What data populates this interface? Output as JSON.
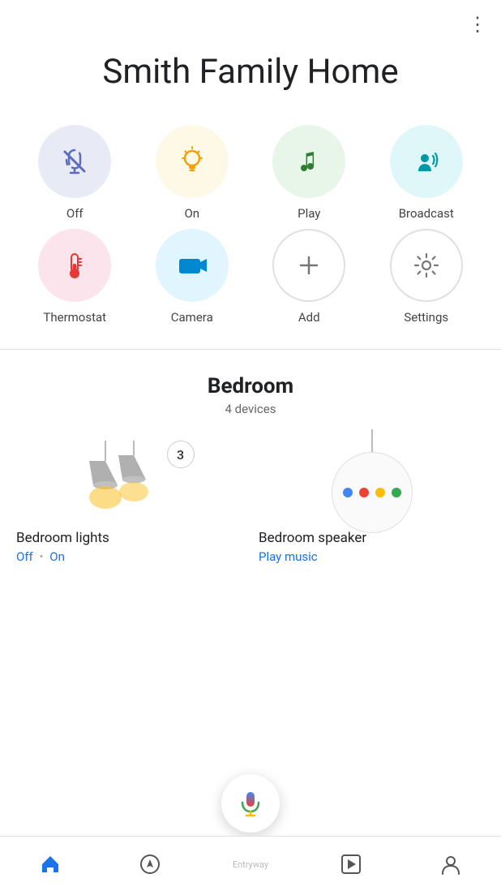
{
  "header": {
    "title": "Smith Family Home",
    "more_icon": "⋮"
  },
  "quick_actions": [
    {
      "id": "off",
      "label": "Off",
      "circle_class": "circle-off",
      "icon": "mic-off"
    },
    {
      "id": "on",
      "label": "On",
      "circle_class": "circle-on",
      "icon": "lightbulb"
    },
    {
      "id": "play",
      "label": "Play",
      "circle_class": "circle-play",
      "icon": "music-note"
    },
    {
      "id": "broadcast",
      "label": "Broadcast",
      "circle_class": "circle-broadcast",
      "icon": "broadcast"
    },
    {
      "id": "thermostat",
      "label": "Thermostat",
      "circle_class": "circle-thermostat",
      "icon": "thermostat"
    },
    {
      "id": "camera",
      "label": "Camera",
      "circle_class": "circle-camera",
      "icon": "camera"
    },
    {
      "id": "add",
      "label": "Add",
      "circle_class": "circle-add",
      "icon": "plus"
    },
    {
      "id": "settings",
      "label": "Settings",
      "circle_class": "circle-settings",
      "icon": "gear"
    }
  ],
  "room": {
    "name": "Bedroom",
    "device_count": "4 devices"
  },
  "devices": [
    {
      "id": "bedroom-lights",
      "name": "Bedroom lights",
      "status_off": "Off",
      "separator": "•",
      "status_on": "On",
      "badge": "3"
    },
    {
      "id": "bedroom-speaker",
      "name": "Bedroom speaker",
      "action": "Play music"
    }
  ],
  "bottom_nav": [
    {
      "id": "home",
      "label": "",
      "icon": "home",
      "active": true
    },
    {
      "id": "explore",
      "label": "",
      "icon": "compass",
      "active": false
    },
    {
      "id": "entryway",
      "label": "Entryway",
      "icon": "",
      "active": false
    },
    {
      "id": "routines",
      "label": "",
      "icon": "play-square",
      "active": false
    },
    {
      "id": "profile",
      "label": "",
      "icon": "person",
      "active": false
    }
  ]
}
